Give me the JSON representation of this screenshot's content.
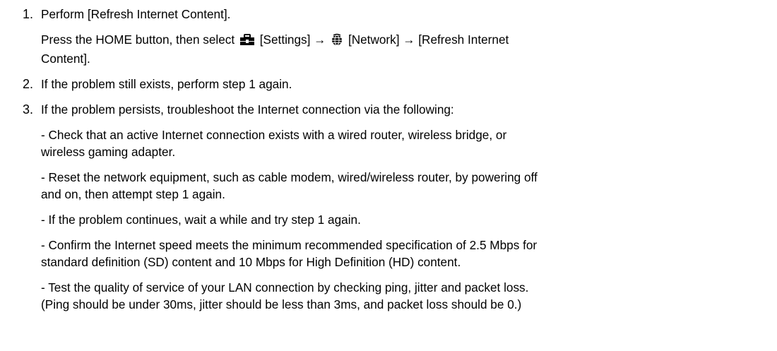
{
  "steps": [
    {
      "number": "1.",
      "title": "Perform [Refresh Internet Content].",
      "instruction": {
        "prefix": "Press the HOME button, then select",
        "settings_icon": "toolbox-icon",
        "settings_label": "[Settings] →",
        "network_icon": "globe-icon",
        "network_label": "[Network] → [Refresh Internet",
        "suffix": "Content]."
      }
    },
    {
      "number": "2.",
      "title": "If the problem still exists, perform step 1 again."
    },
    {
      "number": "3.",
      "title": "If the problem persists, troubleshoot the Internet connection via the following:",
      "bullets": [
        {
          "line1": "- Check that an active Internet connection exists with a wired router, wireless bridge, or",
          "line2": "wireless gaming adapter."
        },
        {
          "line1": "- Reset the network equipment, such as cable modem, wired/wireless router, by powering off",
          "line2": "and on, then attempt step 1 again."
        },
        {
          "line1": "- If the problem continues, wait a while and try step 1 again.",
          "line2": ""
        },
        {
          "line1": "- Confirm the Internet speed meets the minimum recommended specification of 2.5 Mbps for",
          "line2": "standard definition (SD) content and 10 Mbps for High Definition (HD) content."
        },
        {
          "line1": "- Test the quality of service of your LAN connection by checking ping, jitter and packet loss.",
          "line2": "(Ping should be under 30ms, jitter should be less than 3ms, and packet loss should be 0.)"
        }
      ]
    }
  ],
  "colors": {
    "text": "#000000",
    "background": "#ffffff",
    "settings_icon_top": "#000000",
    "settings_icon_body": "#000000",
    "network_icon": "#000000"
  }
}
